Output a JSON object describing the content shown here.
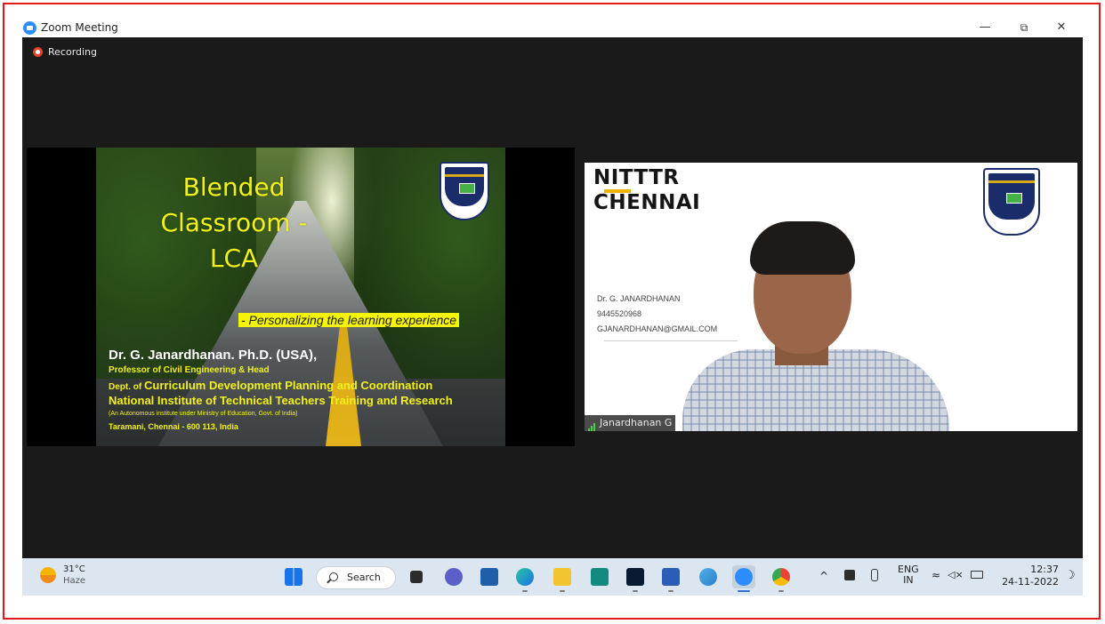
{
  "window": {
    "title": "Zoom Meeting",
    "minimize": "—",
    "restore": "⧉",
    "close": "✕"
  },
  "recording": {
    "label": "Recording"
  },
  "slide": {
    "title_line1": "Blended",
    "title_line2": "Classroom -",
    "title_line3": "LCA",
    "tagline": "- Personalizing the learning experience",
    "name": "Dr. G. Janardhanan. Ph.D. (USA),",
    "position": "Professor of Civil Engineering & Head",
    "dept_prefix": "Dept. of",
    "dept_name": "Curriculum Development Planning and Coordination",
    "institute": "National Institute of Technical Teachers Training and Research",
    "autonomous": "(An Autonomous institute under Ministry of Education, Govt. of India)",
    "address": "Taramani, Chennai - 600 113, India"
  },
  "video": {
    "org_line1": "NITTTR",
    "org_line2": "CHENNAI",
    "contact_name": "Dr. G. JANARDHANAN",
    "contact_phone": "9445520968",
    "contact_email": "GJANARDHANAN@GMAIL.COM",
    "participant_name": "Janardhanan G"
  },
  "taskbar": {
    "weather_temp": "31°C",
    "weather_cond": "Haze",
    "search_label": "Search",
    "lang_line1": "ENG",
    "lang_line2": "IN",
    "time": "12:37",
    "date": "24-11-2022",
    "apps": [
      "start-menu",
      "search",
      "task-view",
      "teams-chat",
      "mail",
      "edge",
      "file-explorer",
      "sway",
      "webex",
      "word",
      "photos",
      "zoom",
      "chrome"
    ]
  },
  "colors": {
    "zoom_blue": "#2d8cff",
    "slide_yellow": "#f2f21a",
    "recording_red": "#e8412c",
    "frame_red": "#e01b1b"
  }
}
